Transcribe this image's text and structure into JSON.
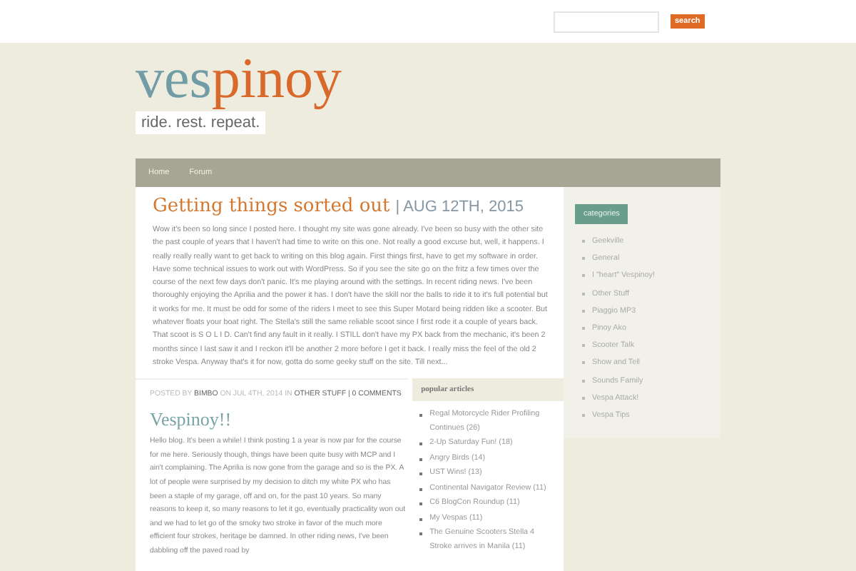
{
  "search": {
    "button": "search"
  },
  "logo": {
    "part_1": "ves",
    "part_2": "pinoy"
  },
  "tagline": "ride. rest. repeat.",
  "nav": [
    "Home",
    "Forum"
  ],
  "post_1": {
    "title": "Getting things sorted out",
    "date": "| AUG 12TH, 2015",
    "body": "Wow it's been so long since I posted here. I thought my site was gone already. I've been so busy with the other site the past couple of years that I haven't had time to write on this one. Not really a good excuse but, well, it happens. I really really really want to get back to writing on this blog again. First things first, have to get my software in order. Have some technical issues to work out with WordPress. So if you see the site go on the fritz a few times over the course of the next few days don't panic. It's me playing around with the settings. In recent riding news. I've been thoroughly enjoying the Aprilia and the power it has. I don't have the skill nor the balls to ride it to it's full potential but it works for me. It must be odd for some of the riders I meet to see this Super Motard being ridden like a scooter. But whatever floats your boat right. The Stella's still the same reliable scoot since I first rode it a couple of years back. That scoot is S O L I D. Can't find any fault in it really. I STILL don't have my PX back from the mechanic, it's been 2 months since I last saw it and I reckon it'll be another 2 more before I get it back. I really miss the feel of the old 2 stroke Vespa. Anyway that's it for now, gotta do some geeky stuff on the site. Till next..."
  },
  "post_2": {
    "meta": "POSTED BY **BIMBO** ON JUL 4TH, 2014 IN **OTHER STUFF | 0 COMMENTS**",
    "title": "Vespinoy!!",
    "body": "Hello blog. It's been a while! I think posting 1 a year is now par for the course for me here. Seriously though, things have been quite busy with MCP and I ain't complaining. The Aprilia is now gone from the garage and so is the PX. A lot of people were surprised by my decision to ditch my white PX who has been a staple of my garage, off and on, for the past 10 years. So many reasons to keep it, so many reasons to let it go, eventually practicality won out and we had to let go of the smoky two stroke in favor of the much more efficient four strokes, heritage be damned. In other riding news, I've been dabbling off the paved road by"
  },
  "popular": {
    "title": "popular articles",
    "items": [
      "Regal Motorcycle Rider Profiling Continues (26)",
      "2-Up Saturday Fun! (18)",
      "Angry Birds (14)",
      "UST Wins! (13)",
      "Continental Navigator Review (11)",
      "C6 BlogCon Roundup (11)",
      "My Vespas (11)",
      "The Genuine Scooters Stella 4 Stroke arrives in Manila (11)"
    ]
  },
  "categories": {
    "title": "categories",
    "items": [
      "Geekville",
      "General",
      "I \"heart\" Vespinoy!",
      "Other Stuff",
      "Piaggio MP3",
      "Pinoy Ako",
      "Scooter Talk",
      "Show and Tell",
      "Sounds Family",
      "Vespa Attack!",
      "Vespa Tips"
    ]
  }
}
